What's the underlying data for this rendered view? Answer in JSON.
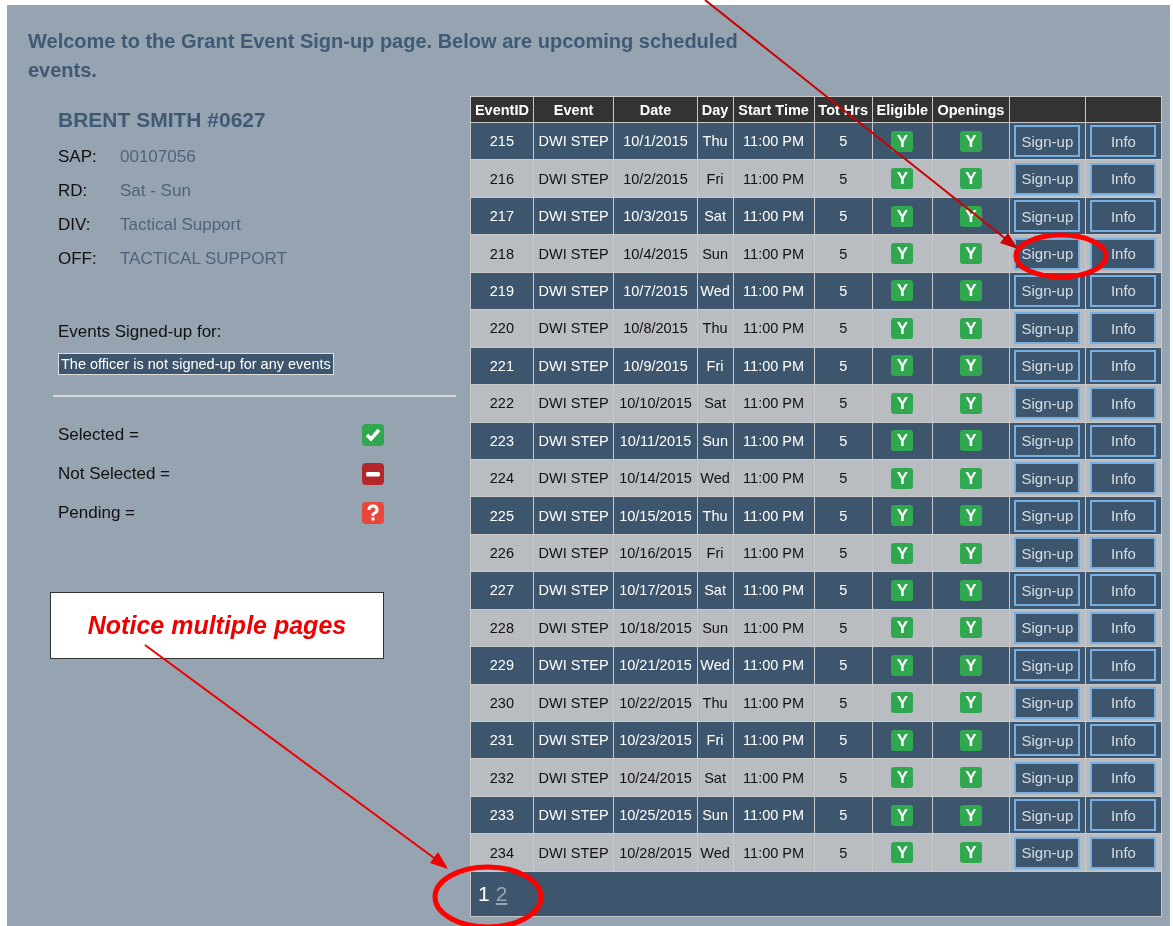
{
  "heading": "Welcome to the Grant Event Sign-up page. Below are upcoming scheduled events.",
  "officer": {
    "name": "BRENT SMITH #0627",
    "fields": [
      {
        "label": "SAP:",
        "value": "00107056"
      },
      {
        "label": "RD:",
        "value": "Sat - Sun"
      },
      {
        "label": "DIV:",
        "value": "Tactical Support"
      },
      {
        "label": "OFF:",
        "value": "TACTICAL SUPPORT"
      }
    ]
  },
  "signed_up": {
    "label": "Events Signed-up for:",
    "message": "The officer is not signed-up for any events"
  },
  "legend": [
    {
      "label": "Selected =",
      "kind": "selected"
    },
    {
      "label": "Not Selected =",
      "kind": "not_selected"
    },
    {
      "label": "Pending =",
      "kind": "pending"
    }
  ],
  "table": {
    "columns": [
      "EventID",
      "Event",
      "Date",
      "Day",
      "Start Time",
      "Tot Hrs",
      "Eligible",
      "Openings"
    ],
    "rows": [
      {
        "id": "215",
        "event": "DWI STEP",
        "date": "10/1/2015",
        "day": "Thu",
        "start": "11:00 PM",
        "hours": "5",
        "eligible": "Y",
        "openings": "Y",
        "signup": "Sign-up",
        "info": "Info"
      },
      {
        "id": "216",
        "event": "DWI STEP",
        "date": "10/2/2015",
        "day": "Fri",
        "start": "11:00 PM",
        "hours": "5",
        "eligible": "Y",
        "openings": "Y",
        "signup": "Sign-up",
        "info": "Info"
      },
      {
        "id": "217",
        "event": "DWI STEP",
        "date": "10/3/2015",
        "day": "Sat",
        "start": "11:00 PM",
        "hours": "5",
        "eligible": "Y",
        "openings": "Y",
        "signup": "Sign-up",
        "info": "Info"
      },
      {
        "id": "218",
        "event": "DWI STEP",
        "date": "10/4/2015",
        "day": "Sun",
        "start": "11:00 PM",
        "hours": "5",
        "eligible": "Y",
        "openings": "Y",
        "signup": "Sign-up",
        "info": "Info"
      },
      {
        "id": "219",
        "event": "DWI STEP",
        "date": "10/7/2015",
        "day": "Wed",
        "start": "11:00 PM",
        "hours": "5",
        "eligible": "Y",
        "openings": "Y",
        "signup": "Sign-up",
        "info": "Info"
      },
      {
        "id": "220",
        "event": "DWI STEP",
        "date": "10/8/2015",
        "day": "Thu",
        "start": "11:00 PM",
        "hours": "5",
        "eligible": "Y",
        "openings": "Y",
        "signup": "Sign-up",
        "info": "Info"
      },
      {
        "id": "221",
        "event": "DWI STEP",
        "date": "10/9/2015",
        "day": "Fri",
        "start": "11:00 PM",
        "hours": "5",
        "eligible": "Y",
        "openings": "Y",
        "signup": "Sign-up",
        "info": "Info"
      },
      {
        "id": "222",
        "event": "DWI STEP",
        "date": "10/10/2015",
        "day": "Sat",
        "start": "11:00 PM",
        "hours": "5",
        "eligible": "Y",
        "openings": "Y",
        "signup": "Sign-up",
        "info": "Info"
      },
      {
        "id": "223",
        "event": "DWI STEP",
        "date": "10/11/2015",
        "day": "Sun",
        "start": "11:00 PM",
        "hours": "5",
        "eligible": "Y",
        "openings": "Y",
        "signup": "Sign-up",
        "info": "Info"
      },
      {
        "id": "224",
        "event": "DWI STEP",
        "date": "10/14/2015",
        "day": "Wed",
        "start": "11:00 PM",
        "hours": "5",
        "eligible": "Y",
        "openings": "Y",
        "signup": "Sign-up",
        "info": "Info"
      },
      {
        "id": "225",
        "event": "DWI STEP",
        "date": "10/15/2015",
        "day": "Thu",
        "start": "11:00 PM",
        "hours": "5",
        "eligible": "Y",
        "openings": "Y",
        "signup": "Sign-up",
        "info": "Info"
      },
      {
        "id": "226",
        "event": "DWI STEP",
        "date": "10/16/2015",
        "day": "Fri",
        "start": "11:00 PM",
        "hours": "5",
        "eligible": "Y",
        "openings": "Y",
        "signup": "Sign-up",
        "info": "Info"
      },
      {
        "id": "227",
        "event": "DWI STEP",
        "date": "10/17/2015",
        "day": "Sat",
        "start": "11:00 PM",
        "hours": "5",
        "eligible": "Y",
        "openings": "Y",
        "signup": "Sign-up",
        "info": "Info"
      },
      {
        "id": "228",
        "event": "DWI STEP",
        "date": "10/18/2015",
        "day": "Sun",
        "start": "11:00 PM",
        "hours": "5",
        "eligible": "Y",
        "openings": "Y",
        "signup": "Sign-up",
        "info": "Info"
      },
      {
        "id": "229",
        "event": "DWI STEP",
        "date": "10/21/2015",
        "day": "Wed",
        "start": "11:00 PM",
        "hours": "5",
        "eligible": "Y",
        "openings": "Y",
        "signup": "Sign-up",
        "info": "Info"
      },
      {
        "id": "230",
        "event": "DWI STEP",
        "date": "10/22/2015",
        "day": "Thu",
        "start": "11:00 PM",
        "hours": "5",
        "eligible": "Y",
        "openings": "Y",
        "signup": "Sign-up",
        "info": "Info"
      },
      {
        "id": "231",
        "event": "DWI STEP",
        "date": "10/23/2015",
        "day": "Fri",
        "start": "11:00 PM",
        "hours": "5",
        "eligible": "Y",
        "openings": "Y",
        "signup": "Sign-up",
        "info": "Info"
      },
      {
        "id": "232",
        "event": "DWI STEP",
        "date": "10/24/2015",
        "day": "Sat",
        "start": "11:00 PM",
        "hours": "5",
        "eligible": "Y",
        "openings": "Y",
        "signup": "Sign-up",
        "info": "Info"
      },
      {
        "id": "233",
        "event": "DWI STEP",
        "date": "10/25/2015",
        "day": "Sun",
        "start": "11:00 PM",
        "hours": "5",
        "eligible": "Y",
        "openings": "Y",
        "signup": "Sign-up",
        "info": "Info"
      },
      {
        "id": "234",
        "event": "DWI STEP",
        "date": "10/28/2015",
        "day": "Wed",
        "start": "11:00 PM",
        "hours": "5",
        "eligible": "Y",
        "openings": "Y",
        "signup": "Sign-up",
        "info": "Info"
      }
    ]
  },
  "pager": [
    {
      "label": "1",
      "selected": true
    },
    {
      "label": "2",
      "selected": false
    }
  ],
  "callout": {
    "text": "Notice multiple pages"
  }
}
